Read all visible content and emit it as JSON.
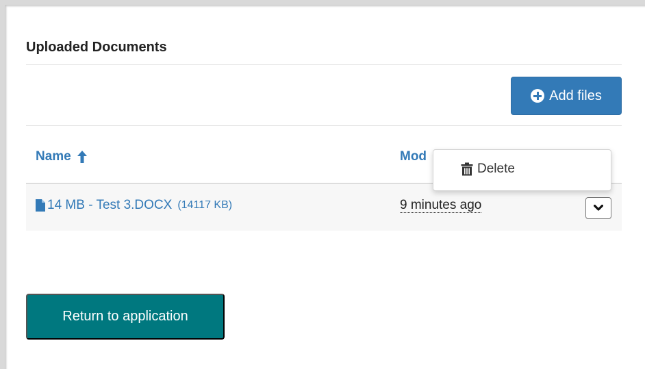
{
  "section": {
    "title": "Uploaded Documents"
  },
  "toolbar": {
    "add_files_label": "Add files",
    "add_icon": "plus-circle-icon"
  },
  "table": {
    "columns": {
      "name": "Name",
      "modified": "Mod"
    },
    "sort": {
      "column": "name",
      "direction": "ascending",
      "icon": "arrow-up-icon"
    },
    "rows": [
      {
        "name": "14 MB - Test 3.DOCX",
        "size": "(14117 KB)",
        "modified": "9 minutes ago",
        "icon": "file-icon"
      }
    ]
  },
  "row_menu": {
    "items": [
      {
        "label": "Delete",
        "icon": "trash-icon"
      }
    ]
  },
  "footer": {
    "return_label": "Return to application"
  },
  "colors": {
    "primary": "#337ab7",
    "teal": "#00787f",
    "row_background": "#f7f7f7",
    "text": "#222222"
  }
}
